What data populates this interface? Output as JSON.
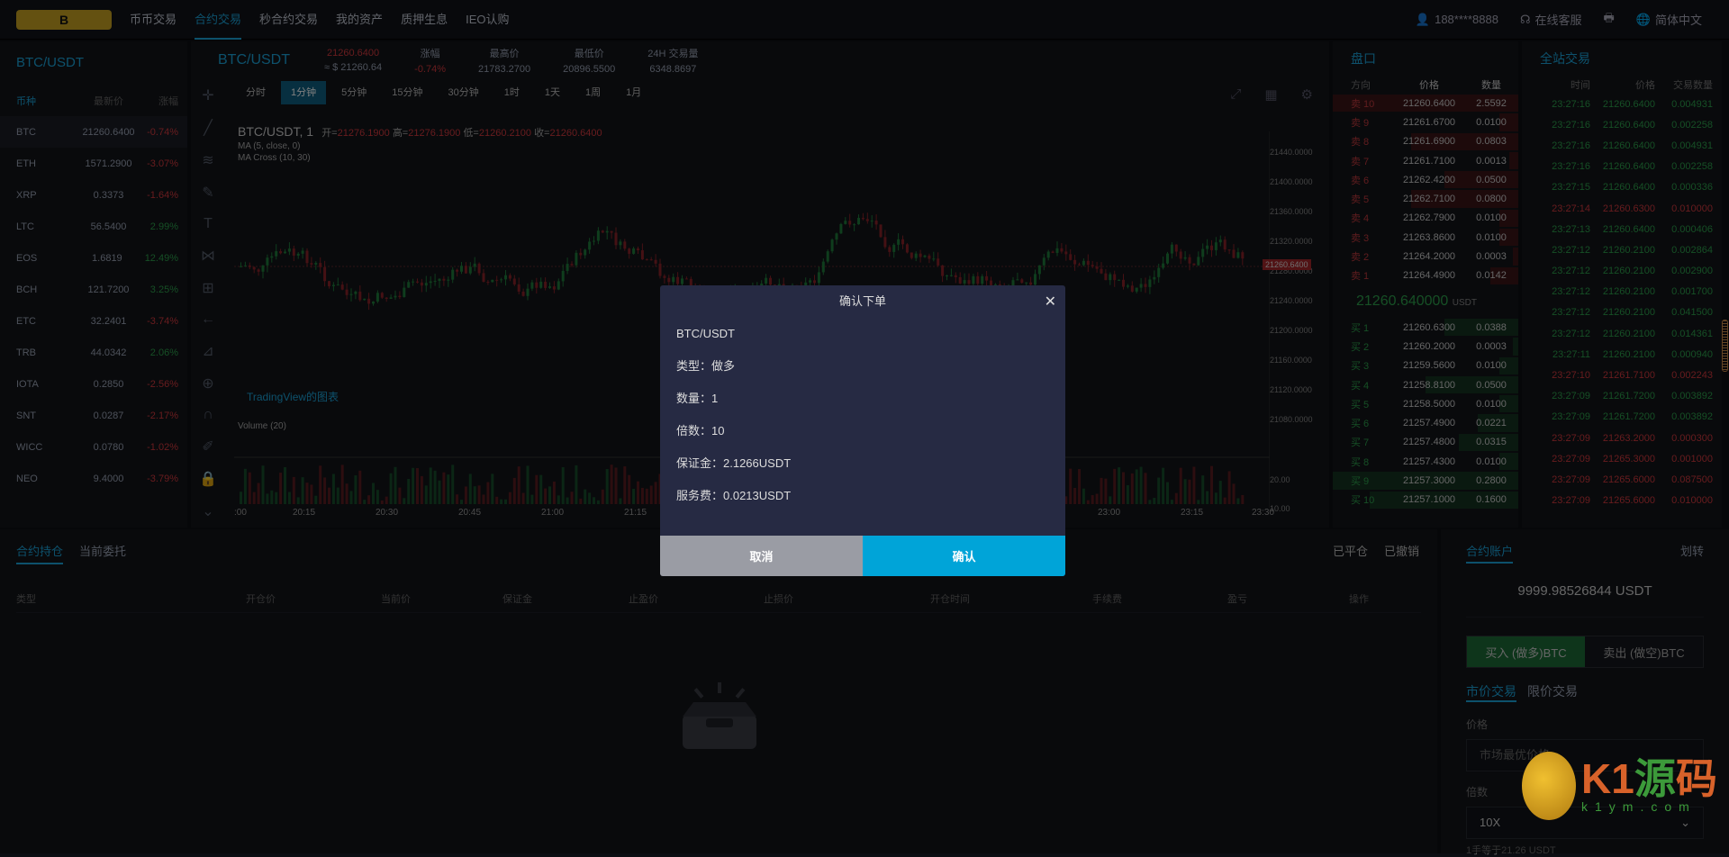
{
  "nav": {
    "logo": "B",
    "items": [
      "币币交易",
      "合约交易",
      "秒合约交易",
      "我的资产",
      "质押生息",
      "IEO认购"
    ],
    "active": 1,
    "user": "188****8888",
    "service": "在线客服",
    "lang": "简体中文"
  },
  "left": {
    "pair": "BTC/USDT",
    "headers": [
      "币种",
      "最新价",
      "涨幅"
    ],
    "coins": [
      {
        "sym": "BTC",
        "price": "21260.6400",
        "chg": "-0.74%",
        "up": false
      },
      {
        "sym": "ETH",
        "price": "1571.2900",
        "chg": "-3.07%",
        "up": false
      },
      {
        "sym": "XRP",
        "price": "0.3373",
        "chg": "-1.64%",
        "up": false
      },
      {
        "sym": "LTC",
        "price": "56.5400",
        "chg": "2.99%",
        "up": true
      },
      {
        "sym": "EOS",
        "price": "1.6819",
        "chg": "12.49%",
        "up": true
      },
      {
        "sym": "BCH",
        "price": "121.7200",
        "chg": "3.25%",
        "up": true
      },
      {
        "sym": "ETC",
        "price": "32.2401",
        "chg": "-3.74%",
        "up": false
      },
      {
        "sym": "TRB",
        "price": "44.0342",
        "chg": "2.06%",
        "up": true
      },
      {
        "sym": "IOTA",
        "price": "0.2850",
        "chg": "-2.56%",
        "up": false
      },
      {
        "sym": "SNT",
        "price": "0.0287",
        "chg": "-2.17%",
        "up": false
      },
      {
        "sym": "WICC",
        "price": "0.0780",
        "chg": "-1.02%",
        "up": false
      },
      {
        "sym": "NEO",
        "price": "9.4000",
        "chg": "-3.79%",
        "up": false
      }
    ]
  },
  "ticker": {
    "pair": "BTC/USDT",
    "price": "21260.6400",
    "usd": "≈ $ 21260.64",
    "chg_label": "涨幅",
    "chg": "-0.74%",
    "high_label": "最高价",
    "high": "21783.2700",
    "low_label": "最低价",
    "low": "20896.5500",
    "vol_label": "24H 交易量",
    "vol": "6348.8697"
  },
  "chart": {
    "intervals": [
      "分时",
      "1分钟",
      "5分钟",
      "15分钟",
      "30分钟",
      "1时",
      "1天",
      "1周",
      "1月"
    ],
    "active": 1,
    "title": "BTC/USDT, 1",
    "o_label": "开=",
    "o": "21276.1900",
    "h_label": "高=",
    "h": "21276.1900",
    "l_label": "低=",
    "l": "21260.2100",
    "c_label": "收=",
    "c": "21260.6400",
    "ma": "MA (5, close, 0)",
    "macross": "MA Cross (10, 30)",
    "tv": "TradingView的图表",
    "volume": "Volume (20)",
    "yticks": [
      "21440.0000",
      "21400.0000",
      "21360.0000",
      "21320.0000",
      "21280.0000",
      "21240.0000",
      "21200.0000",
      "21160.0000",
      "21120.0000",
      "21080.0000"
    ],
    "price_tag": "21260.6400",
    "vticks": [
      "20.00",
      "10.00",
      "0.00"
    ],
    "xticks": [
      ":00",
      "20:15",
      "20:30",
      "20:45",
      "21:00",
      "21:15",
      "23:00",
      "23:15",
      "23:30"
    ]
  },
  "orderbook": {
    "title": "盘口",
    "headers": [
      "方向",
      "价格",
      "数量"
    ],
    "asks": [
      [
        "卖 10",
        "21260.6400",
        "2.5592",
        100
      ],
      [
        "卖 9",
        "21261.6700",
        "0.0100",
        10
      ],
      [
        "卖 8",
        "21261.6900",
        "0.0803",
        58
      ],
      [
        "卖 7",
        "21261.7100",
        "0.0013",
        5
      ],
      [
        "卖 6",
        "21262.4200",
        "0.0500",
        40
      ],
      [
        "卖 5",
        "21262.7100",
        "0.0800",
        58
      ],
      [
        "卖 4",
        "21262.7900",
        "0.0100",
        10
      ],
      [
        "卖 3",
        "21263.8600",
        "0.0100",
        10
      ],
      [
        "卖 2",
        "21264.2000",
        "0.0003",
        3
      ],
      [
        "卖 1",
        "21264.4900",
        "0.0142",
        15
      ]
    ],
    "mid": "21260.640000",
    "mid_unit": "USDT",
    "bids": [
      [
        "买 1",
        "21260.6300",
        "0.0388",
        40
      ],
      [
        "买 2",
        "21260.2000",
        "0.0003",
        3
      ],
      [
        "买 3",
        "21259.5600",
        "0.0100",
        10
      ],
      [
        "买 4",
        "21258.8100",
        "0.0500",
        50
      ],
      [
        "买 5",
        "21258.5000",
        "0.0100",
        10
      ],
      [
        "买 6",
        "21257.4900",
        "0.0221",
        22
      ],
      [
        "买 7",
        "21257.4800",
        "0.0315",
        32
      ],
      [
        "买 8",
        "21257.4300",
        "0.0100",
        10
      ],
      [
        "买 9",
        "21257.3000",
        "0.2800",
        100
      ],
      [
        "买 10",
        "21257.1000",
        "0.1600",
        80
      ]
    ]
  },
  "trades": {
    "title": "全站交易",
    "headers": [
      "时间",
      "价格",
      "交易数量"
    ],
    "rows": [
      [
        "23:27:16",
        "21260.6400",
        "0.004931",
        true
      ],
      [
        "23:27:16",
        "21260.6400",
        "0.002258",
        true
      ],
      [
        "23:27:16",
        "21260.6400",
        "0.004931",
        true
      ],
      [
        "23:27:16",
        "21260.6400",
        "0.002258",
        true
      ],
      [
        "23:27:15",
        "21260.6400",
        "0.000336",
        true
      ],
      [
        "23:27:14",
        "21260.6300",
        "0.010000",
        false
      ],
      [
        "23:27:13",
        "21260.6400",
        "0.000406",
        true
      ],
      [
        "23:27:12",
        "21260.2100",
        "0.002864",
        true
      ],
      [
        "23:27:12",
        "21260.2100",
        "0.002900",
        true
      ],
      [
        "23:27:12",
        "21260.2100",
        "0.001700",
        true
      ],
      [
        "23:27:12",
        "21260.2100",
        "0.041500",
        true
      ],
      [
        "23:27:12",
        "21260.2100",
        "0.014361",
        true
      ],
      [
        "23:27:11",
        "21260.2100",
        "0.000940",
        true
      ],
      [
        "23:27:10",
        "21261.7100",
        "0.002243",
        false
      ],
      [
        "23:27:09",
        "21261.7200",
        "0.003892",
        true
      ],
      [
        "23:27:09",
        "21261.7200",
        "0.003892",
        true
      ],
      [
        "23:27:09",
        "21263.2000",
        "0.000300",
        false
      ],
      [
        "23:27:09",
        "21265.3000",
        "0.001000",
        false
      ],
      [
        "23:27:09",
        "21265.6000",
        "0.087500",
        false
      ],
      [
        "23:27:09",
        "21265.6000",
        "0.010000",
        false
      ]
    ]
  },
  "positions": {
    "tabs": [
      "合约持仓",
      "当前委托"
    ],
    "right": [
      "已平仓",
      "已撤销"
    ],
    "headers": [
      "类型",
      "开仓价",
      "当前价",
      "保证金",
      "止盈价",
      "止损价",
      "开仓时间",
      "手续费",
      "盈亏",
      "操作"
    ]
  },
  "account": {
    "title": "合约账户",
    "transfer": "划转",
    "balance": "9999.98526844 USDT",
    "buy": "买入 (做多)BTC",
    "sell": "卖出 (做空)BTC",
    "market": "市价交易",
    "limit": "限价交易",
    "price_label": "价格",
    "price_placeholder": "市场最优价格",
    "lev_label": "倍数",
    "lev": "10X",
    "note": "1手等于21.26 USDT"
  },
  "modal": {
    "title": "确认下单",
    "pair": "BTC/USDT",
    "lines": [
      "类型：做多",
      "数量：1",
      "倍数：10",
      "保证金：2.1266USDT",
      "服务费：0.0213USDT"
    ],
    "cancel": "取消",
    "confirm": "确认"
  },
  "watermark": {
    "text": "K1源码",
    "url": "k1ym.com"
  }
}
